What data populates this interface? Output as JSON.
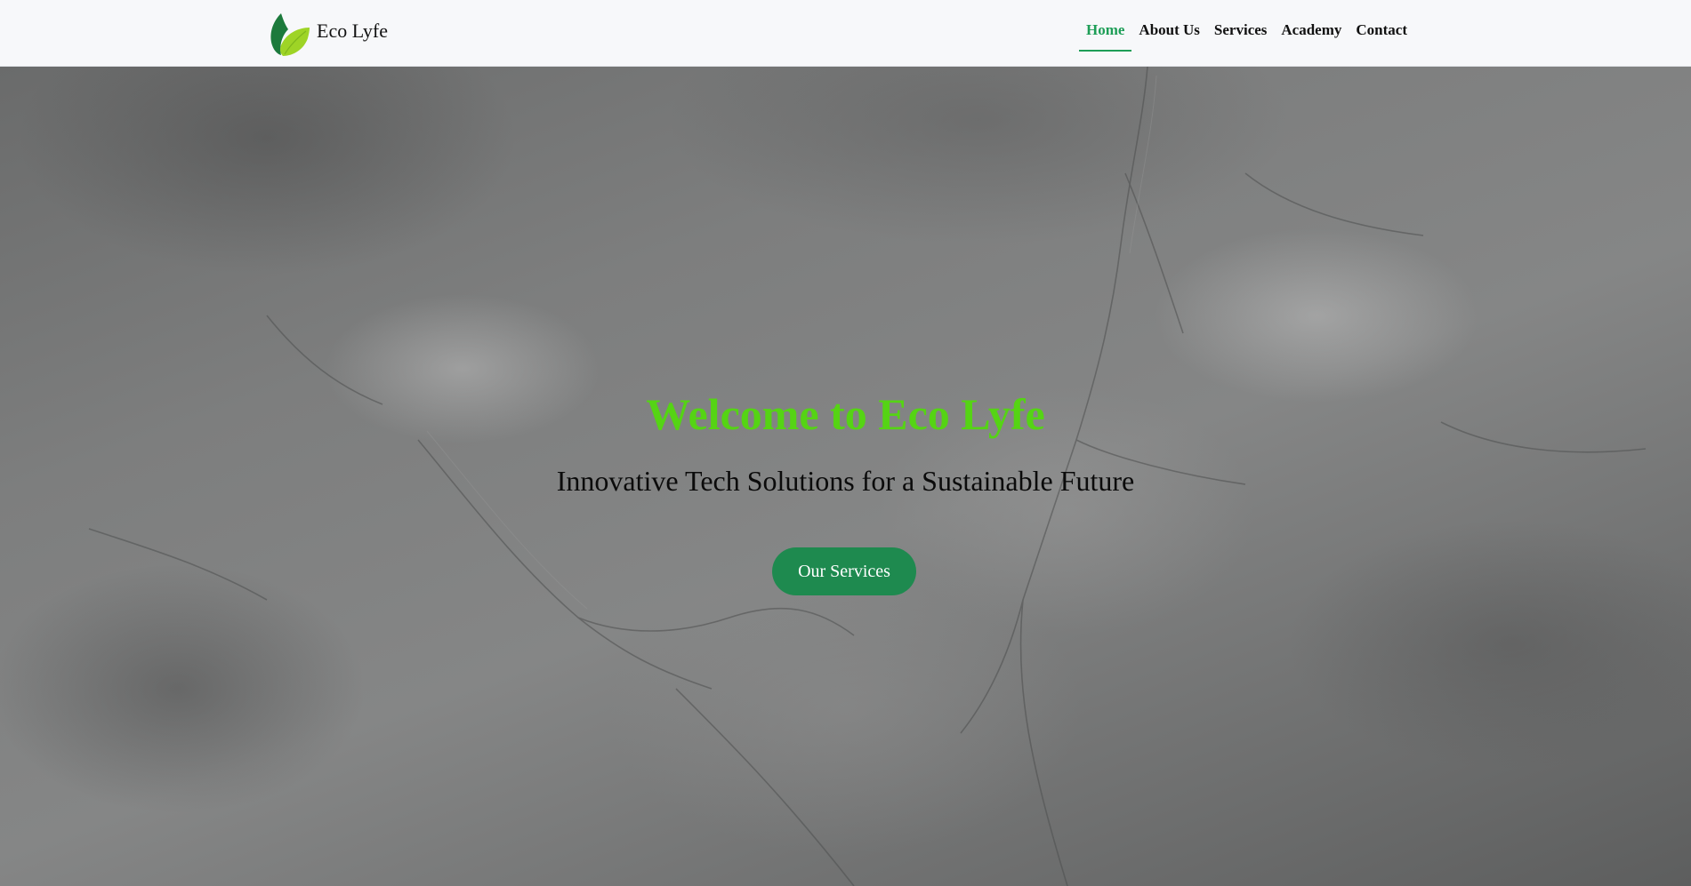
{
  "brand": {
    "name": "Eco Lyfe",
    "logo_icon": "leaf-icon",
    "colors": {
      "dark_leaf": "#1c7a3c",
      "light_leaf": "#9ed426"
    }
  },
  "nav": {
    "items": [
      {
        "label": "Home",
        "active": true
      },
      {
        "label": "About Us",
        "active": false
      },
      {
        "label": "Services",
        "active": false
      },
      {
        "label": "Academy",
        "active": false
      },
      {
        "label": "Contact",
        "active": false
      }
    ]
  },
  "hero": {
    "title": "Welcome to Eco Lyfe",
    "subtitle": "Innovative Tech Solutions for a Sustainable Future",
    "cta_label": "Our Services"
  },
  "colors": {
    "accent": "#1e9e57",
    "title_green": "#55d414",
    "button_green": "#1e8a4f",
    "nav_background": "#f7f8fa"
  }
}
